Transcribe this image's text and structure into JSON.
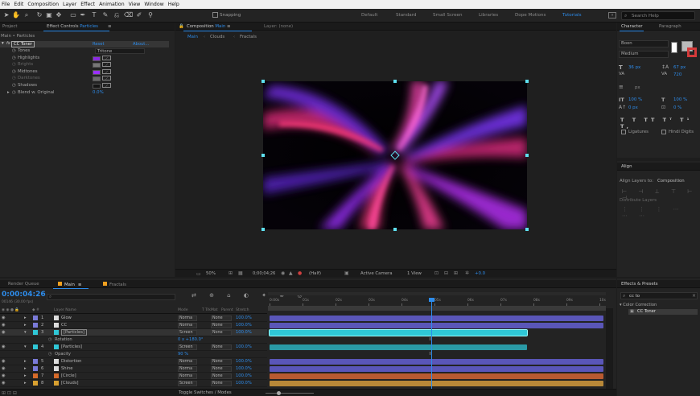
{
  "menu": [
    "File",
    "Edit",
    "Composition",
    "Layer",
    "Effect",
    "Animation",
    "View",
    "Window",
    "Help"
  ],
  "toolbar": {
    "snapping_label": "Snapping",
    "workspaces": [
      "Default",
      "Standard",
      "Small Screen",
      "Libraries",
      "Dope Motions",
      "Tutorials"
    ],
    "active_workspace": "Tutorials",
    "search_placeholder": "Search Help"
  },
  "left_panel": {
    "tab_project": "Project",
    "tab_effect_controls": "Effect Controls",
    "effect_layer_name": "Particles",
    "subtitle": "Main • Particles",
    "effect_name": "CC Toner",
    "reset_label": "Reset",
    "about_label": "About...",
    "properties": [
      {
        "name": "Tones",
        "value": "Tritone"
      },
      {
        "name": "Highlights",
        "color": "#8a2be2"
      },
      {
        "name": "Brights",
        "color": "#777777"
      },
      {
        "name": "Midtones",
        "color": "#9b30ff"
      },
      {
        "name": "Darktones",
        "color": "#6a6a6a"
      },
      {
        "name": "Shadows",
        "color": "#151515"
      },
      {
        "name": "Blend w. Original",
        "value": "0.0%"
      }
    ]
  },
  "viewer": {
    "tab_composition": "Composition",
    "comp_name": "Main",
    "layer_tab": "Layer: (none)",
    "breadcrumbs": [
      "Main",
      "Clouds",
      "Fractals"
    ],
    "zoom": "50%",
    "timecode": "0;00;04;26",
    "resolution": "(Half)",
    "camera": "Active Camera",
    "views": "1 View",
    "exposure": "+0.0"
  },
  "character": {
    "tab_character": "Character",
    "tab_paragraph": "Paragraph",
    "font": "Boon",
    "style": "Medium",
    "size": "36 px",
    "leading": "67 px",
    "tracking": "720",
    "vscale": "100 %",
    "hscale": "100 %",
    "baseline": "0 px",
    "tsume": "0 %",
    "stroke_unit": "px",
    "ligatures": "Ligatures",
    "hindi_digits": "Hindi Digits"
  },
  "align": {
    "title": "Align",
    "align_to_label": "Align Layers to:",
    "align_to_value": "Composition",
    "distribute_label": "Distribute Layers"
  },
  "timeline": {
    "tabs": [
      "Render Queue",
      "Main",
      "Fractals"
    ],
    "active_tab": "Main",
    "timecode": "0:00:04:26",
    "fps_info": "00146 (30.00 fps)",
    "search_placeholder": "",
    "columns": {
      "name": "Layer Name",
      "mode": "Mode",
      "trkmat": "T TrkMat",
      "parent": "Parent",
      "stretch": "Stretch"
    },
    "ruler": [
      "0:00s",
      "01s",
      "02s",
      "03s",
      "04s",
      "05s",
      "06s",
      "07s",
      "08s",
      "09s",
      "10s"
    ],
    "playhead_fraction": 0.49,
    "layers": [
      {
        "num": "1",
        "name": "Glow",
        "label_color": "#7a7ad8",
        "mode": "Norma",
        "parent": "None",
        "stretch": "100.0%",
        "bar_color": "#5a56b8",
        "bar_end_fraction": 1.0
      },
      {
        "num": "2",
        "name": "CC",
        "label_color": "#7a7ad8",
        "mode": "Norma",
        "parent": "None",
        "stretch": "100.0%",
        "bar_color": "#5a56b8",
        "bar_end_fraction": 1.0
      },
      {
        "num": "3",
        "name": "[Particles]",
        "label_color": "#2fc7d6",
        "mode": "Screen",
        "parent": "None",
        "stretch": "100.0%",
        "bar_color": "#2fc7d6",
        "bar_end_fraction": 0.77,
        "selected": true
      },
      {
        "num": "",
        "name": "Rotation",
        "value": "0 x +180.0°",
        "is_property": true
      },
      {
        "num": "4",
        "name": "[Particles]",
        "label_color": "#2fc7d6",
        "mode": "Screen",
        "parent": "None",
        "stretch": "100.0%",
        "bar_color": "#2a9aa6",
        "bar_end_fraction": 0.77
      },
      {
        "num": "",
        "name": "Opacity",
        "value": "90 %",
        "is_property": true
      },
      {
        "num": "5",
        "name": "Distortion",
        "label_color": "#7a7ad8",
        "mode": "Norma",
        "parent": "None",
        "stretch": "100.0%",
        "bar_color": "#5a56b8",
        "bar_end_fraction": 1.0
      },
      {
        "num": "6",
        "name": "Shine",
        "label_color": "#7a7ad8",
        "mode": "Norma",
        "parent": "None",
        "stretch": "100.0%",
        "bar_color": "#5a56b8",
        "bar_end_fraction": 1.0
      },
      {
        "num": "7",
        "name": "[Circle]",
        "label_color": "#d66a2a",
        "mode": "Norma",
        "parent": "None",
        "stretch": "100.0%",
        "bar_color": "#b85a30",
        "bar_end_fraction": 1.0
      },
      {
        "num": "8",
        "name": "[Clouds]",
        "label_color": "#d8a030",
        "mode": "Screen",
        "parent": "None",
        "stretch": "100.0%",
        "bar_color": "#b88838",
        "bar_end_fraction": 1.0
      }
    ],
    "toggle_label": "Toggle Switches / Modes"
  },
  "effects_presets": {
    "title": "Effects & Presets",
    "search_value": "cc to",
    "category": "Color Correction",
    "item": "CC Toner"
  }
}
